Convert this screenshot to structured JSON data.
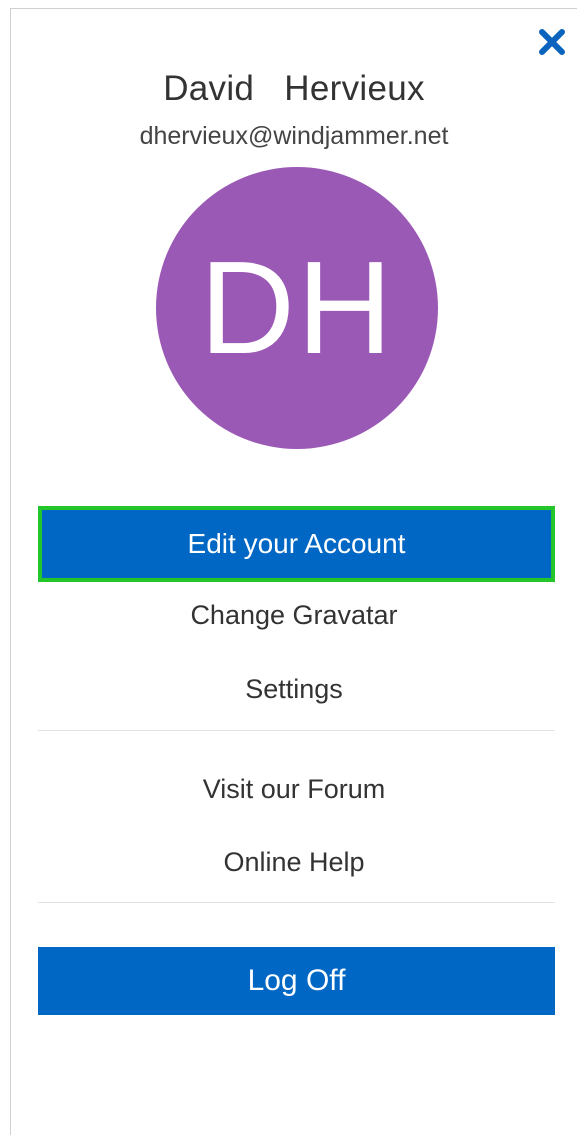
{
  "profile": {
    "first_name": "David",
    "last_name": "Hervieux",
    "name_display": "David   Hervieux",
    "email": "dhervieux@windjammer.net",
    "initials": "DH"
  },
  "menu": {
    "edit_account": "Edit your Account",
    "change_gravatar": "Change Gravatar",
    "settings": "Settings",
    "visit_forum": "Visit our Forum",
    "online_help": "Online Help",
    "log_off": "Log Off"
  },
  "icons": {
    "close": "close-icon"
  },
  "colors": {
    "avatar_bg": "#9b59b6",
    "primary_button": "#0067c5",
    "focus_outline": "#22c52a",
    "close_icon": "#0a63bd"
  }
}
